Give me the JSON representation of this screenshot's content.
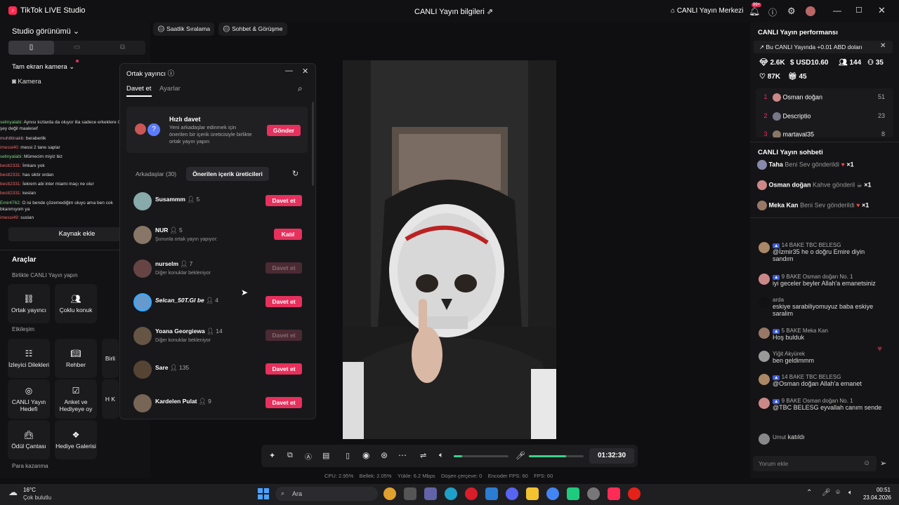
{
  "app": {
    "title": "TikTok LIVE Studio",
    "live_info": "CANLI Yayın bilgileri",
    "live_center": "CANLI Yayın Merkezi",
    "notif_count": "99+"
  },
  "left": {
    "studio_view": "Studio görünümü",
    "fullscreen_camera": "Tam ekran kamera",
    "camera": "Kamera",
    "add_source": "Kaynak ekle",
    "tools": "Araçlar",
    "live_together": "Birlikte CANLI Yayın yapın",
    "cohost": "Ortak yayıncı",
    "multi_guest": "Çoklu konuk",
    "interaction": "Etkileşim",
    "viewer_requests": "İzleyici Dilekleri",
    "guide": "Rehber",
    "partial": "Birli",
    "live_goal": "CANLI Yayın Hedefi",
    "poll": "Anket ve Hediyeye oy",
    "partial2": "H K",
    "reward_bag": "Ödül Çantası",
    "gift_gallery": "Hediye Galerisi",
    "earnings": "Para kazanma",
    "chat": [
      {
        "user": "selinyalabi:",
        "text": "Aynısı kızlarda da oluyor ilia sadece erkeklere özgü bir şey değil maalesef"
      },
      {
        "user": "muhittinakb:",
        "text": "beraberlik"
      },
      {
        "user": "imessi40:",
        "text": "messi 2 tane saplar"
      },
      {
        "user": "selinyalabi:",
        "text": "Mümecim miyiz biz"
      },
      {
        "user": "bestt2331:",
        "text": "İmkanı yok"
      },
      {
        "user": "bestt2331:",
        "text": "has siktir ordan"
      },
      {
        "user": "bestt2331:",
        "text": "İekrem abi inter miami maçı ne olur"
      },
      {
        "user": "bestt2331:",
        "text": "keslan"
      },
      {
        "user": "Emir4762:",
        "text": "O isi bende çözemediğim oluyo ama ben cok bkanmıyom ya"
      },
      {
        "user": "imessi49:",
        "text": "suslan"
      }
    ]
  },
  "chips": {
    "hourly": "Saatlik Sıralama",
    "chat": "Sohbet & Görüşme"
  },
  "modal": {
    "title": "Ortak yayıncı",
    "tab_invite": "Davet et",
    "tab_settings": "Ayarlar",
    "quick_invite": "Hızlı davet",
    "quick_desc": "Yeni arkadaşlar edinmek için önerilen bir içerik üreticisiyle birlikte ortak yayın yapın",
    "send": "Gönder",
    "friends_tab": "Arkadaşlar (30)",
    "suggested_tab": "Önerilen içerik üreticileri",
    "rows": [
      {
        "name": "Susammm",
        "count": "5",
        "sub": "",
        "btn": "Davet et",
        "disabled": false
      },
      {
        "name": "NUR",
        "count": "5",
        "sub": "Şununla ortak yayın yapıyor:",
        "btn": "Katıl",
        "disabled": false
      },
      {
        "name": "nurselm",
        "count": "7",
        "sub": "Diğer konuklar bekleniyor",
        "btn": "Davet et",
        "disabled": true
      },
      {
        "name": "Selcan_50T.Gl be",
        "count": "4",
        "sub": "",
        "btn": "Davet et",
        "disabled": false
      },
      {
        "name": "Yoana Georgiewa",
        "count": "14",
        "sub": "Diğer konuklar bekleniyor",
        "btn": "Davet et",
        "disabled": true
      },
      {
        "name": "Sare",
        "count": "135",
        "sub": "",
        "btn": "Davet et",
        "disabled": false
      },
      {
        "name": "Kardelen Pulat",
        "count": "9",
        "sub": "",
        "btn": "Davet et",
        "disabled": false
      }
    ]
  },
  "controls": {
    "timer": "01:32:30"
  },
  "stats": {
    "cpu": "CPU: 2.95%",
    "mem": "Bellek: 2.05%",
    "upload": "Yükle: 6.2 Mbps",
    "dropped": "Düşen çerçeve: 0",
    "encoder": "Encoder FPS: 60",
    "fps": "FPS: 60"
  },
  "right": {
    "perf_title": "CANLI Yayın performansı",
    "banner": "Bu CANLI Yayında +0.01 ABD doları",
    "diamonds": "2.6K",
    "usd": "USD10.60",
    "viewers": "144",
    "new_followers": "35",
    "likes": "87K",
    "gifters": "45",
    "ranking": [
      {
        "rank": "1",
        "name": "Osman doğan",
        "score": "51"
      },
      {
        "rank": "2",
        "name": "Descriptio",
        "score": "23"
      },
      {
        "rank": "3",
        "name": "martaval35",
        "score": "8"
      }
    ],
    "chat_title": "CANLI Yayın sohbeti",
    "gifts": [
      {
        "name": "Taha",
        "text": "Beni Sev gönderildi",
        "count": "×1"
      },
      {
        "name": "Osman doğan",
        "text": "Kahve gönderil",
        "count": "×1"
      },
      {
        "name": "Meka Kan",
        "text": "Beni Sev gönderildi",
        "count": "×1"
      }
    ],
    "comments": [
      {
        "meta": "14 BAKE TBC BELESG",
        "text": "@İzmir35 he o doğru Emire diyin sandım"
      },
      {
        "meta": "9 BAKE Osman doğan No. 1",
        "text": "iyi geceler beyler Allah'a emanetsiniz"
      },
      {
        "meta": "arda",
        "text": "eskiye sarabiliyomuyuz baba eskiye saralim"
      },
      {
        "meta": "5 BAKE Meka Kan",
        "text": "Hoş bulduk"
      },
      {
        "meta": "Yiğit Akyürek",
        "text": "ben geldimmm"
      },
      {
        "meta": "14 BAKE TBC BELESG",
        "text": "@Osman doğan Allah'a emanet"
      },
      {
        "meta": "9 BAKE Osman doğan No. 1",
        "text": "@TBC BELESG eyvallah canım sende"
      },
      {
        "meta": "Umut",
        "text": "katıldı"
      }
    ],
    "comment_placeholder": "Yorum ekle"
  },
  "taskbar": {
    "weather_temp": "16°C",
    "weather_desc": "Çok bulutlu",
    "search": "Ara",
    "time": "00:51",
    "date": "23.04.2026"
  }
}
